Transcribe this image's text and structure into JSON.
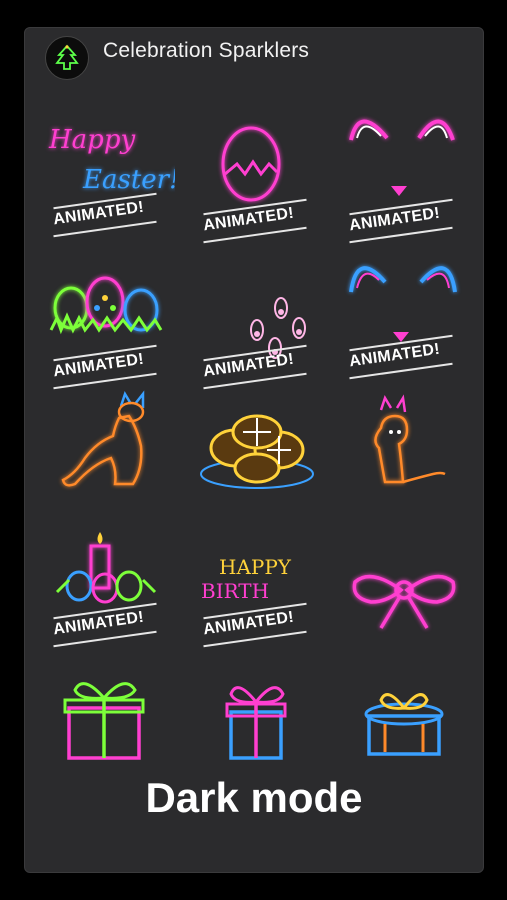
{
  "header": {
    "title": "Celebration Sparklers",
    "icon": "christmas-tree-icon"
  },
  "badge_label": "ANIMATED!",
  "stickers": [
    {
      "name": "happy-easter",
      "text1": "Happy",
      "text2": "Easter!",
      "animated": true
    },
    {
      "name": "neon-egg",
      "animated": true
    },
    {
      "name": "bunny-ears-pink",
      "animated": true
    },
    {
      "name": "easter-eggs-grass",
      "animated": true
    },
    {
      "name": "bunny-footprints",
      "animated": true
    },
    {
      "name": "bunny-ears-blue",
      "animated": true
    },
    {
      "name": "cat-with-ears",
      "animated": false
    },
    {
      "name": "hot-cross-buns",
      "animated": false
    },
    {
      "name": "dog-with-ears",
      "animated": false
    },
    {
      "name": "candle-eggs",
      "animated": true
    },
    {
      "name": "happy-birth",
      "text1": "HAPPY",
      "text2": "BIRTH",
      "animated": true
    },
    {
      "name": "pink-bow",
      "animated": false
    },
    {
      "name": "gift-green",
      "animated": false
    },
    {
      "name": "gift-pink",
      "animated": false
    },
    {
      "name": "gift-blue",
      "animated": false
    }
  ],
  "footer": {
    "mode_label": "Dark mode"
  },
  "colors": {
    "pink": "#ff3fd0",
    "blue": "#3aa0ff",
    "green": "#7dff3a",
    "yellow": "#ffd23a",
    "orange": "#ff8a2a",
    "cyan": "#3ff0ff"
  }
}
